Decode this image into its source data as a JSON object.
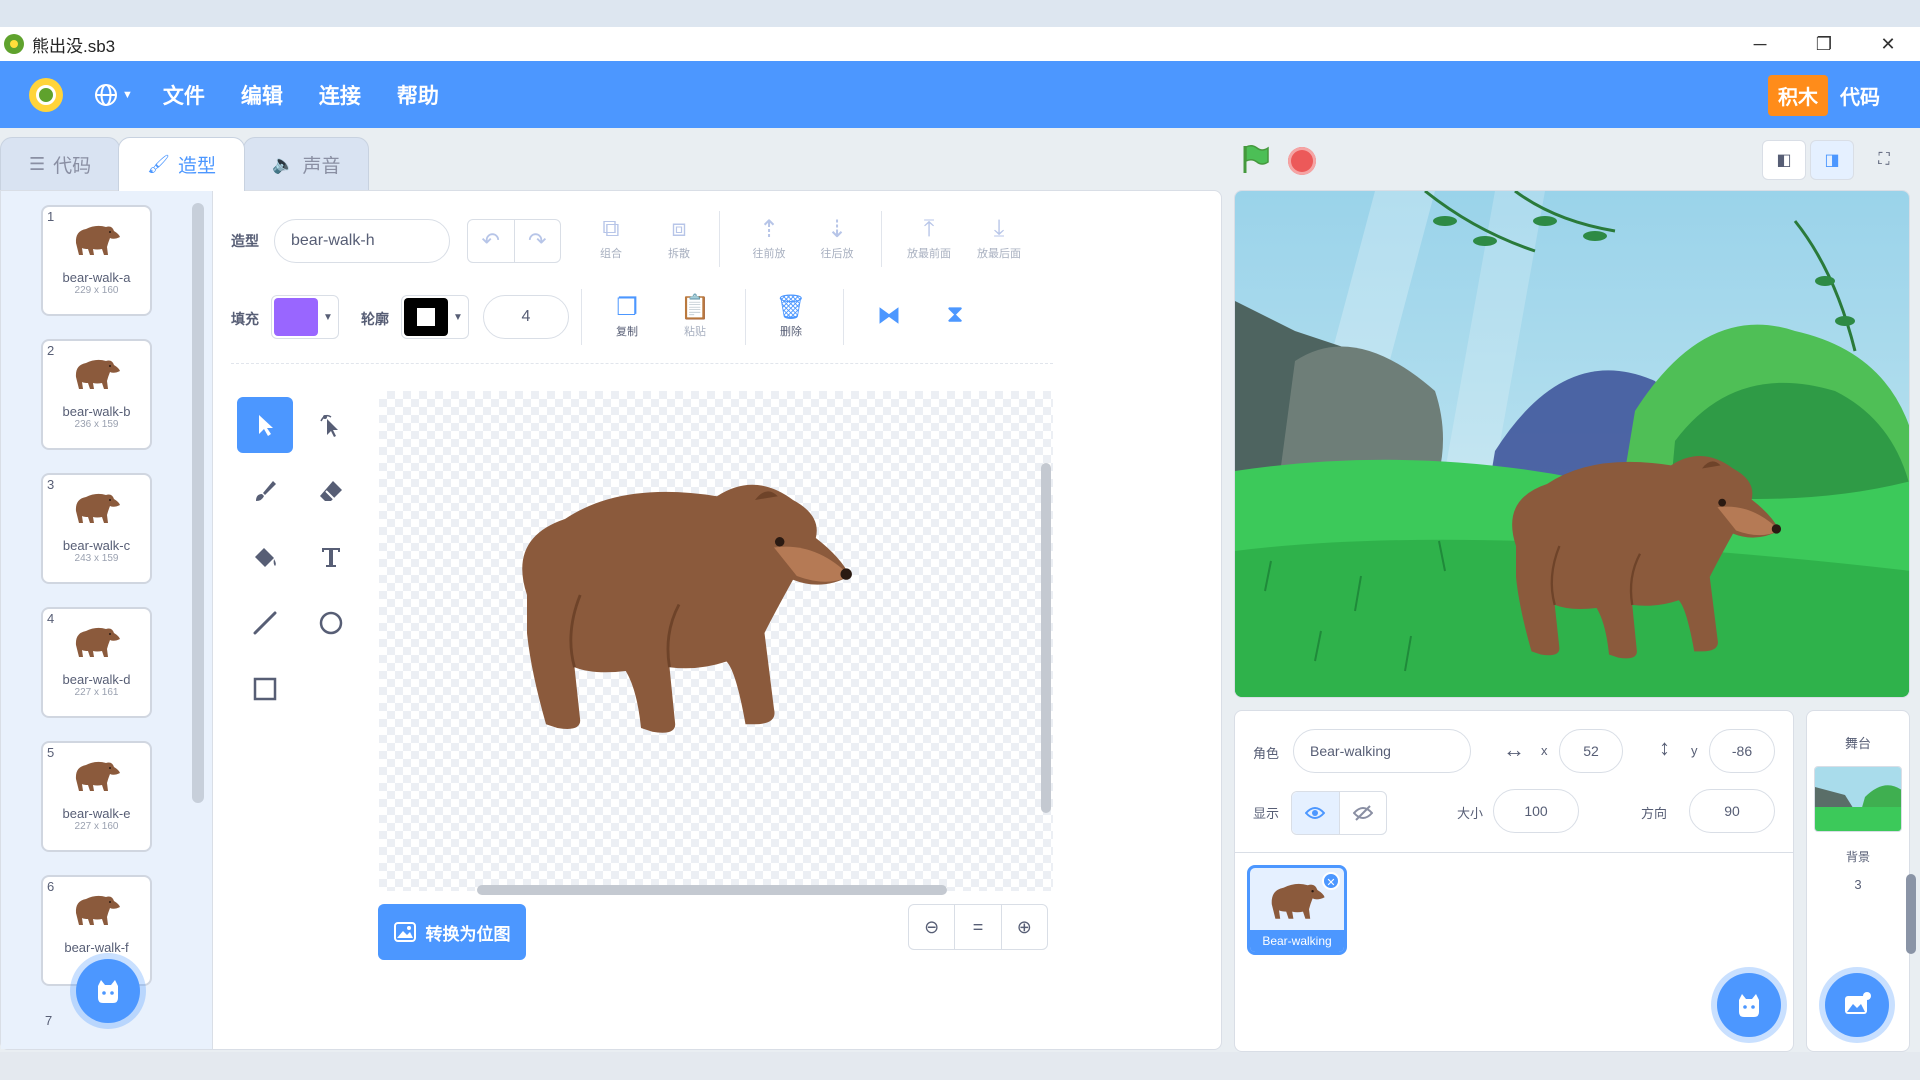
{
  "window": {
    "title": "熊出没.sb3",
    "controls": {
      "minimize": "─",
      "restore": "❐",
      "close": "✕"
    }
  },
  "menu": {
    "items": [
      "文件",
      "编辑",
      "连接",
      "帮助"
    ],
    "mode_blocks": "积木",
    "mode_code": "代码"
  },
  "tabs": [
    {
      "label": "代码",
      "icon": "code-icon"
    },
    {
      "label": "造型",
      "icon": "brush-icon",
      "active": true
    },
    {
      "label": "声音",
      "icon": "speaker-icon"
    }
  ],
  "costumes": [
    {
      "num": "1",
      "name": "bear-walk-a",
      "size": "229 x 160"
    },
    {
      "num": "2",
      "name": "bear-walk-b",
      "size": "236 x 159"
    },
    {
      "num": "3",
      "name": "bear-walk-c",
      "size": "243 x 159"
    },
    {
      "num": "4",
      "name": "bear-walk-d",
      "size": "227 x 161"
    },
    {
      "num": "5",
      "name": "bear-walk-e",
      "size": "227 x 160"
    },
    {
      "num": "6",
      "name": "bear-walk-f",
      "size": ""
    }
  ],
  "costume_next_num": "7",
  "paint": {
    "costume_label": "造型",
    "costume_name": "bear-walk-h",
    "fill_label": "填充",
    "outline_label": "轮廓",
    "outline_width": "4",
    "fill_color": "#9966FF",
    "outline_color": "#000000",
    "actions": {
      "group": "组合",
      "ungroup": "拆散",
      "forward": "往前放",
      "backward": "往后放",
      "front": "放最前面",
      "back": "放最后面",
      "copy": "复制",
      "paste": "粘贴",
      "delete": "删除"
    },
    "convert_button": "转换为位图"
  },
  "sprite_info": {
    "sprite_label": "角色",
    "sprite_name": "Bear-walking",
    "x_label": "x",
    "x_value": "52",
    "y_label": "y",
    "y_value": "-86",
    "show_label": "显示",
    "size_label": "大小",
    "size_value": "100",
    "direction_label": "方向",
    "direction_value": "90"
  },
  "sprite_tile": {
    "name": "Bear-walking"
  },
  "stage_panel": {
    "title": "舞台",
    "backdrop_label": "背景",
    "backdrop_count": "3"
  },
  "colors": {
    "accent": "#4C97FF",
    "orange": "#FF8C1A",
    "bear": "#8B5A3C",
    "grass": "#3CC95A"
  }
}
